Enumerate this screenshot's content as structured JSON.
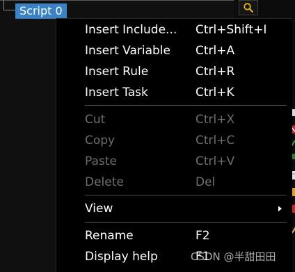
{
  "tree": {
    "selected_node_label": "Script 0"
  },
  "toolbar": {
    "search_icon": "magnifier-icon",
    "accent_color": "#e8b21e"
  },
  "context_menu": {
    "groups": [
      [
        {
          "label": "Insert Include...",
          "shortcut": "Ctrl+Shift+I",
          "enabled": true
        },
        {
          "label": "Insert Variable",
          "shortcut": "Ctrl+A",
          "enabled": true
        },
        {
          "label": "Insert Rule",
          "shortcut": "Ctrl+R",
          "enabled": true
        },
        {
          "label": "Insert Task",
          "shortcut": "Ctrl+K",
          "enabled": true
        }
      ],
      [
        {
          "label": "Cut",
          "shortcut": "Ctrl+X",
          "enabled": false
        },
        {
          "label": "Copy",
          "shortcut": "Ctrl+C",
          "enabled": false
        },
        {
          "label": "Paste",
          "shortcut": "Ctrl+V",
          "enabled": false
        },
        {
          "label": "Delete",
          "shortcut": "Del",
          "enabled": false
        }
      ],
      [
        {
          "label": "View",
          "shortcut": "",
          "enabled": true,
          "submenu": true
        }
      ],
      [
        {
          "label": "Rename",
          "shortcut": "F2",
          "enabled": true
        },
        {
          "label": "Display help",
          "shortcut": "F1",
          "enabled": true
        }
      ]
    ],
    "selection_color": "#3b82c4",
    "disabled_color": "#6f6f6f"
  },
  "watermark": {
    "text": "CSDN @半甜田田"
  }
}
